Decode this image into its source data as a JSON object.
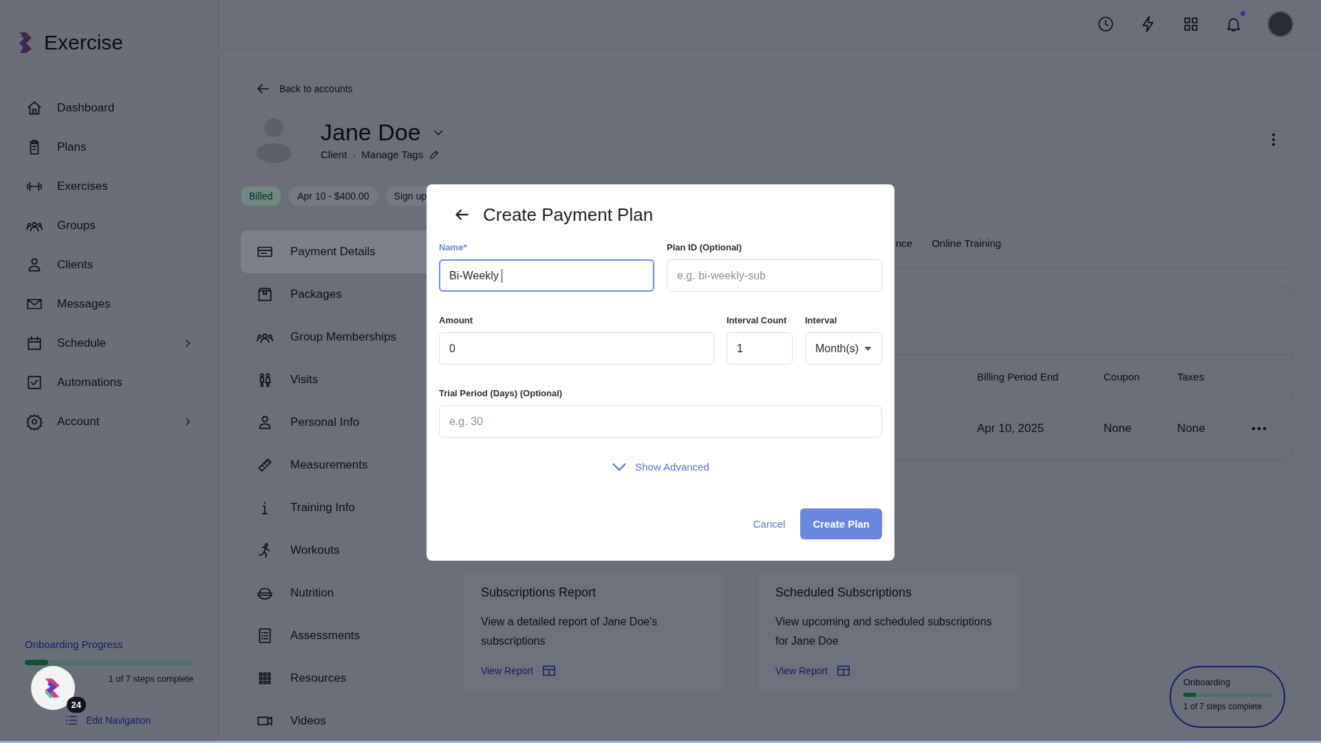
{
  "app": {
    "name": "Exercise"
  },
  "sidebar": {
    "items": [
      {
        "label": "Dashboard",
        "expandable": false
      },
      {
        "label": "Plans",
        "expandable": false
      },
      {
        "label": "Exercises",
        "expandable": false
      },
      {
        "label": "Groups",
        "expandable": false
      },
      {
        "label": "Clients",
        "expandable": false
      },
      {
        "label": "Messages",
        "expandable": false
      },
      {
        "label": "Schedule",
        "expandable": true
      },
      {
        "label": "Automations",
        "expandable": false
      },
      {
        "label": "Account",
        "expandable": true
      }
    ]
  },
  "onboarding": {
    "title": "Onboarding Progress",
    "level": 0.14,
    "caption": "1 of 7 steps complete"
  },
  "chat": {
    "badge": "24"
  },
  "edit_navigation": "Edit Navigation",
  "notifications": {
    "unread": true
  },
  "back_link": "Back to accounts",
  "client": {
    "name": "Jane Doe",
    "role": "Client",
    "separator": "·",
    "tags_link": "Manage Tags"
  },
  "chips": [
    {
      "label": "Billed",
      "kind": "status"
    },
    {
      "label": "Apr 10 - $400.00",
      "kind": "plain"
    },
    {
      "label": "Sign up",
      "kind": "plain"
    }
  ],
  "menu": [
    {
      "label": "Payment Details",
      "selected": true
    },
    {
      "label": "Packages",
      "selected": false
    },
    {
      "label": "Group Memberships",
      "selected": false
    },
    {
      "label": "Visits",
      "selected": false
    },
    {
      "label": "Personal Info",
      "selected": false
    },
    {
      "label": "Measurements",
      "selected": false
    },
    {
      "label": "Training Info",
      "selected": false
    },
    {
      "label": "Workouts",
      "selected": false
    },
    {
      "label": "Nutrition",
      "selected": false
    },
    {
      "label": "Assessments",
      "selected": false
    },
    {
      "label": "Resources",
      "selected": false
    },
    {
      "label": "Videos",
      "selected": false
    }
  ],
  "tabs": [
    "nce",
    "Online Training"
  ],
  "table": {
    "columns": [
      "Billing Period End",
      "Coupon",
      "Taxes"
    ],
    "rows": [
      [
        "Apr 10, 2025",
        "None",
        "None"
      ]
    ]
  },
  "reports": [
    {
      "title": "Subscriptions Report",
      "description": "View a detailed report of Jane Doe's subscriptions",
      "link": "View Report"
    },
    {
      "title": "Scheduled Subscriptions",
      "description": "View upcoming and scheduled subscriptions for Jane Doe",
      "link": "View Report"
    }
  ],
  "onboarding_widget": {
    "title": "Onboarding",
    "level": 0.14,
    "caption": "1 of 7 steps complete"
  },
  "dialog": {
    "title": "Create Payment Plan",
    "rows": [
      [
        {
          "label": "Name*",
          "kind": "text",
          "value": "Bi-Weekly",
          "focused": true
        },
        {
          "label": "Plan ID (Optional)",
          "kind": "text",
          "placeholder": "e.g. bi-weekly-sub",
          "focused": false
        }
      ],
      [
        {
          "label": "Amount",
          "kind": "text",
          "value": "0",
          "focused": false
        },
        {
          "label": "Interval Count",
          "kind": "text",
          "value": "1",
          "focused": false
        },
        {
          "label": "Interval",
          "kind": "select",
          "value": "Month(s)",
          "focused": false
        }
      ],
      [
        {
          "label": "Trial Period (Days) (Optional)",
          "kind": "text",
          "placeholder": "e.g. 30",
          "focused": false
        }
      ]
    ],
    "advanced": {
      "label": "Show Advanced",
      "expanded": false
    },
    "buttons": [
      {
        "label": "Cancel",
        "kind": "text"
      },
      {
        "label": "Create Plan",
        "kind": "primary"
      }
    ]
  }
}
